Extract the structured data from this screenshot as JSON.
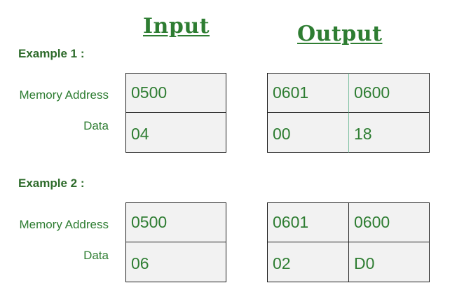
{
  "headings": {
    "input": "Input",
    "output": "Output"
  },
  "examples": [
    {
      "title": "Example 1 :",
      "labels": {
        "address": "Memory Address",
        "data": "Data"
      },
      "input": {
        "address": "0500",
        "data": "04"
      },
      "output": {
        "addresses": [
          "0601",
          "0600"
        ],
        "data": [
          "00",
          "18"
        ]
      }
    },
    {
      "title": "Example 2 :",
      "labels": {
        "address": "Memory Address",
        "data": "Data"
      },
      "input": {
        "address": "0500",
        "data": "06"
      },
      "output": {
        "addresses": [
          "0601",
          "0600"
        ],
        "data": [
          "02",
          "D0"
        ]
      }
    }
  ],
  "colors": {
    "heading": "#2e7d32",
    "text": "#2e7d32",
    "cell_background": "#f2f2f2",
    "border": "#222222"
  }
}
